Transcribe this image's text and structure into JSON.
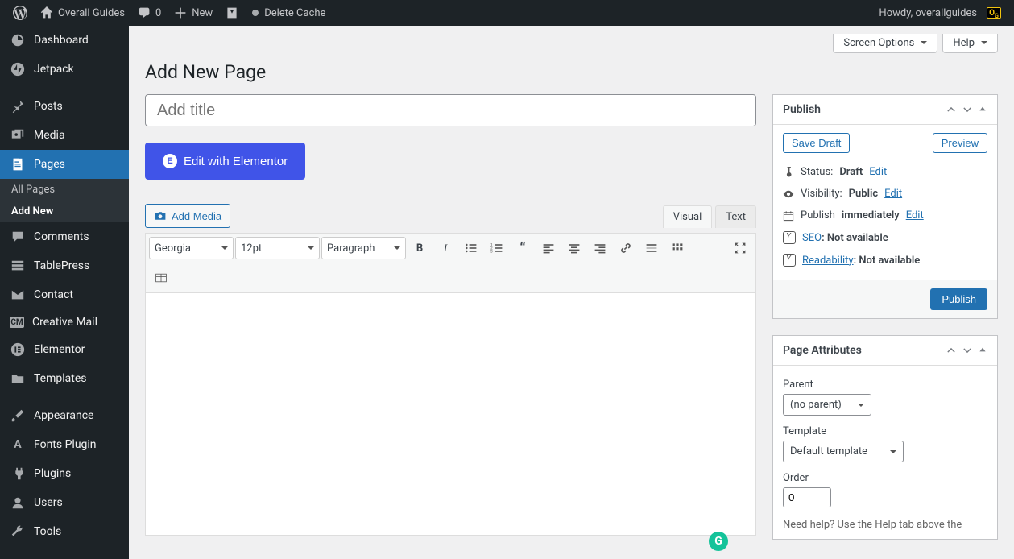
{
  "topbar": {
    "site_name": "Overall Guides",
    "comments_count": "0",
    "new_label": "New",
    "delete_cache": "Delete Cache",
    "greeting": "Howdy, overallguides"
  },
  "sidebar": {
    "items": [
      {
        "label": "Dashboard"
      },
      {
        "label": "Jetpack"
      },
      {
        "label": "Posts"
      },
      {
        "label": "Media"
      },
      {
        "label": "Pages"
      },
      {
        "label": "Comments"
      },
      {
        "label": "TablePress"
      },
      {
        "label": "Contact"
      },
      {
        "label": "Creative Mail"
      },
      {
        "label": "Elementor"
      },
      {
        "label": "Templates"
      },
      {
        "label": "Appearance"
      },
      {
        "label": "Fonts Plugin"
      },
      {
        "label": "Plugins"
      },
      {
        "label": "Users"
      },
      {
        "label": "Tools"
      }
    ],
    "submenu": {
      "all_pages": "All Pages",
      "add_new": "Add New"
    }
  },
  "screen_meta": {
    "screen_options": "Screen Options",
    "help": "Help"
  },
  "page": {
    "heading": "Add New Page",
    "title_placeholder": "Add title",
    "elementor_btn": "Edit with Elementor",
    "add_media": "Add Media",
    "tabs": {
      "visual": "Visual",
      "text": "Text"
    },
    "toolbar": {
      "font": "Georgia",
      "size": "12pt",
      "format": "Paragraph"
    }
  },
  "publish": {
    "title": "Publish",
    "save_draft": "Save Draft",
    "preview": "Preview",
    "status_label": "Status:",
    "status_value": "Draft",
    "visibility_label": "Visibility:",
    "visibility_value": "Public",
    "publish_label": "Publish",
    "publish_value": "immediately",
    "seo_label": "SEO",
    "seo_value": ": Not available",
    "readability_label": "Readability",
    "readability_value": ": Not available",
    "edit": "Edit",
    "publish_btn": "Publish"
  },
  "attributes": {
    "title": "Page Attributes",
    "parent_label": "Parent",
    "parent_value": "(no parent)",
    "template_label": "Template",
    "template_value": "Default template",
    "order_label": "Order",
    "order_value": "0",
    "help_text": "Need help? Use the Help tab above the"
  }
}
